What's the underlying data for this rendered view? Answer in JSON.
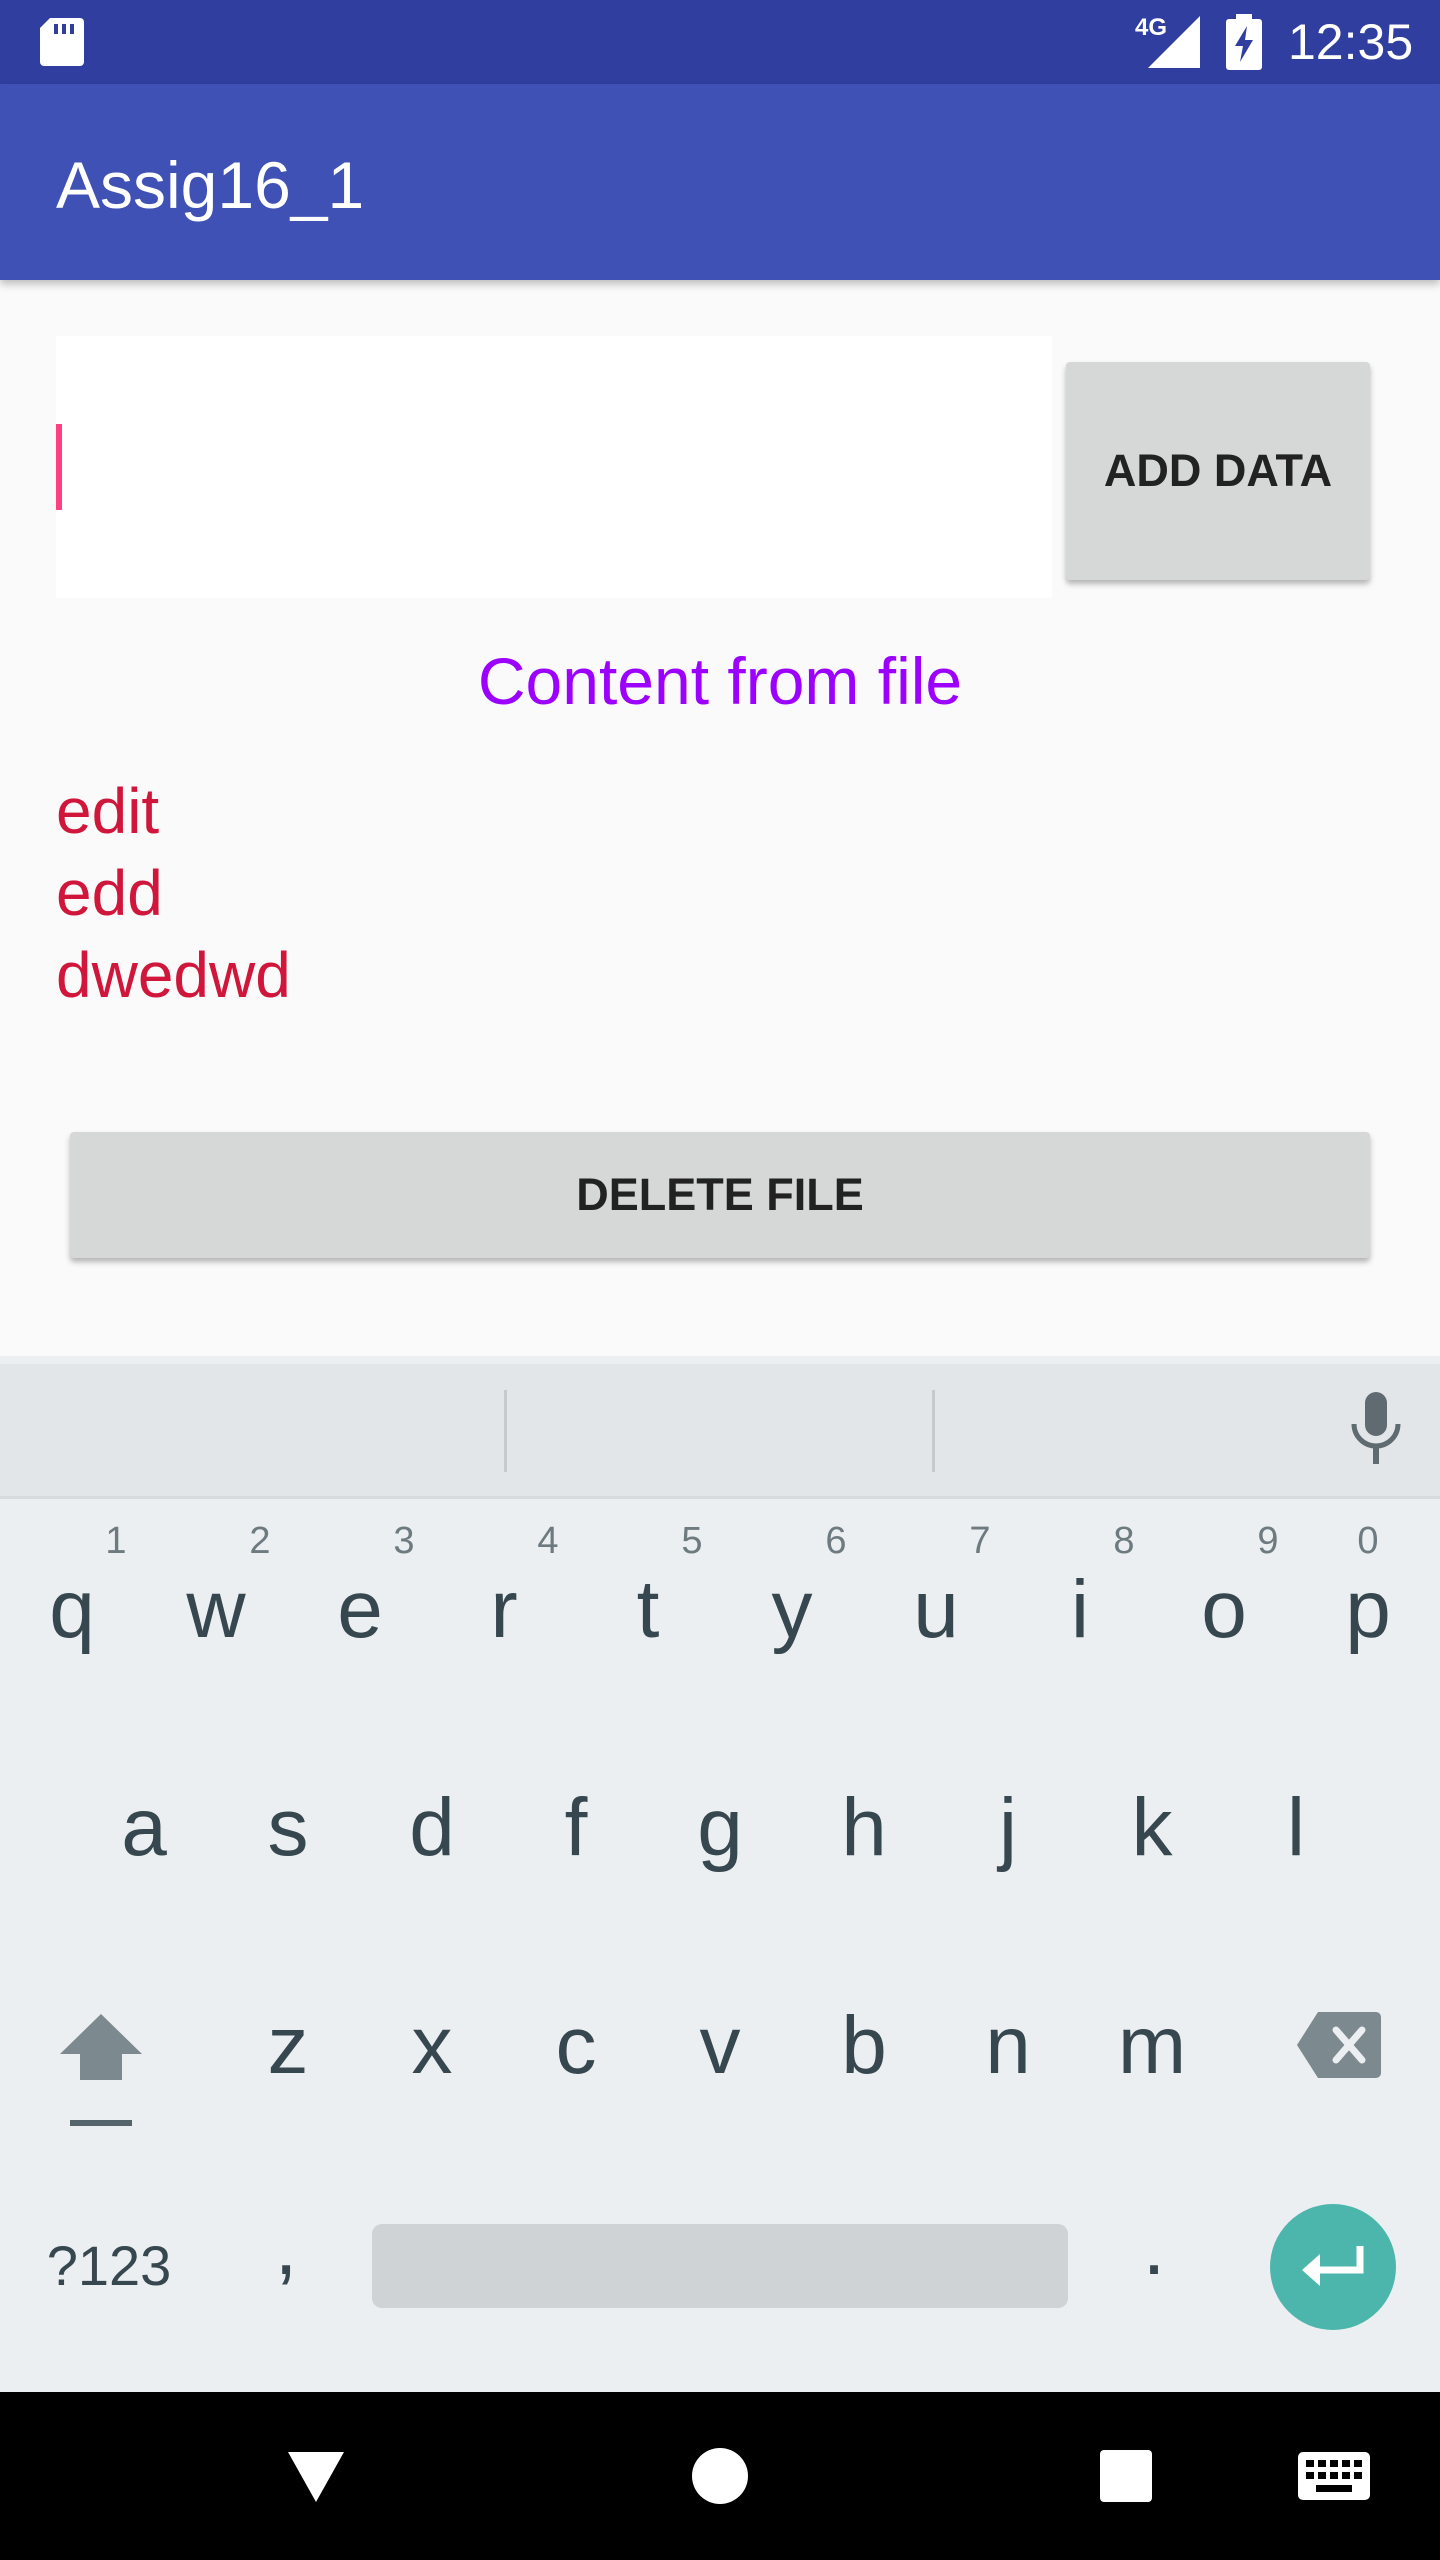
{
  "status_bar": {
    "network": "4G",
    "time": "12:35",
    "icons": [
      "sd-card-icon",
      "signal-icon",
      "battery-charging-icon"
    ]
  },
  "app_bar": {
    "title": "Assig16_1"
  },
  "form": {
    "input_value": "",
    "add_button_label": "ADD DATA"
  },
  "content": {
    "heading": "Content from file",
    "lines": [
      "edit",
      "edd",
      "dwedwd"
    ]
  },
  "delete_button_label": "DELETE FILE",
  "keyboard": {
    "row1": [
      "q",
      "w",
      "e",
      "r",
      "t",
      "y",
      "u",
      "i",
      "o",
      "p"
    ],
    "row1_hints": [
      "1",
      "2",
      "3",
      "4",
      "5",
      "6",
      "7",
      "8",
      "9",
      "0"
    ],
    "row2": [
      "a",
      "s",
      "d",
      "f",
      "g",
      "h",
      "j",
      "k",
      "l"
    ],
    "row3": [
      "z",
      "x",
      "c",
      "v",
      "b",
      "n",
      "m"
    ],
    "symbols_label": "?123",
    "comma": ",",
    "period": ".",
    "icons": [
      "mic-icon",
      "shift-icon",
      "backspace-icon",
      "enter-icon"
    ]
  },
  "nav_bar": {
    "icons": [
      "back-icon",
      "home-icon",
      "recents-icon",
      "keyboard-switch-icon"
    ]
  },
  "colors": {
    "status_bar": "#303f9f",
    "app_bar": "#3f51b5",
    "caret": "#ff4081",
    "heading": "#9c00ff",
    "file_text": "#d0163a",
    "enter_key": "#4db6ac"
  }
}
